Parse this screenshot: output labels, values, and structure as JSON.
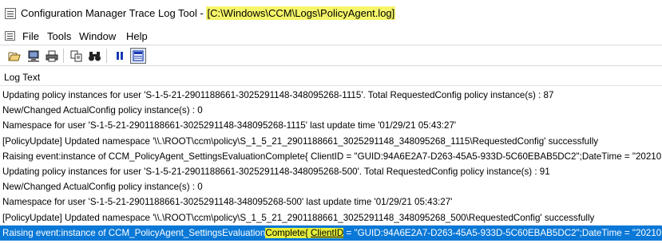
{
  "window": {
    "title_prefix": "Configuration Manager Trace Log Tool - ",
    "title_path": "[C:\\Windows\\CCM\\Logs\\PolicyAgent.log]",
    "icon": "document-list-icon"
  },
  "menu": {
    "items": [
      {
        "label": "File"
      },
      {
        "label": "Tools"
      },
      {
        "label": "Window"
      },
      {
        "label": "Help"
      }
    ]
  },
  "toolbar": {
    "buttons": [
      {
        "name": "open-folder-icon"
      },
      {
        "name": "computer-icon"
      },
      {
        "name": "print-icon"
      },
      {
        "name": "copy-icon"
      },
      {
        "name": "find-binoculars-icon"
      },
      {
        "name": "pause-icon"
      },
      {
        "name": "details-pane-icon"
      }
    ],
    "accent": "#1a3bb3"
  },
  "columns": {
    "log_text": "Log Text"
  },
  "log": {
    "rows": [
      "Updating policy instances for user 'S-1-5-21-2901188661-3025291148-348095268-1115'. Total RequestedConfig policy instance(s) : 87",
      "New/Changed ActualConfig policy instance(s) : 0",
      "Namespace for user 'S-1-5-21-2901188661-3025291148-348095268-1115' last update time '01/29/21 05:43:27'",
      "[PolicyUpdate] Updated namespace '\\\\.\\ROOT\\ccm\\policy\\S_1_5_21_2901188661_3025291148_348095268_1115\\RequestedConfig' successfully",
      "Raising event:instance of CCM_PolicyAgent_SettingsEvaluationComplete{ ClientID = \"GUID:94A6E2A7-D263-45A5-933D-5C60EBAB5DC2\";DateTime = \"20210...",
      "Updating policy instances for user 'S-1-5-21-2901188661-3025291148-348095268-500'. Total RequestedConfig policy instance(s) : 91",
      "New/Changed ActualConfig policy instance(s) : 0",
      "Namespace for user 'S-1-5-21-2901188661-3025291148-348095268-500' last update time '01/29/21 05:43:27'",
      "[PolicyUpdate] Updated namespace '\\\\.\\ROOT\\ccm\\policy\\S_1_5_21_2901188661_3025291148_348095268_500\\RequestedConfig' successfully"
    ],
    "selected_row": {
      "part1": "Raising event:instance of CCM_PolicyAgent_SettingsEvaluation",
      "part2": "Complete{ ",
      "part3": "ClientID",
      "part4": " = \"GUID:94A6E2A7-D263-45A5-933D-5C60EBAB5DC2\";DateTime = \"20210..."
    },
    "selected_bg": "#0a78d7",
    "highlight_color": "#e5ef3c"
  }
}
